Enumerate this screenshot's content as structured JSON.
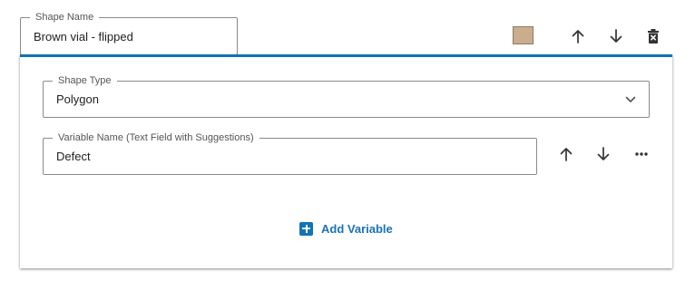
{
  "shape": {
    "name_legend": "Shape Name",
    "name_value": "Brown vial - flipped",
    "color": "#c9ad8d"
  },
  "shape_type": {
    "legend": "Shape Type",
    "value": "Polygon"
  },
  "variable": {
    "legend": "Variable Name (Text Field with Suggestions)",
    "value": "Defect"
  },
  "actions": {
    "add_variable_label": "Add Variable"
  },
  "colors": {
    "accent": "#0f73b6",
    "icon": "#333333"
  },
  "icons": [
    "arrow-up-icon",
    "arrow-down-icon",
    "delete-icon",
    "chevron-down-icon",
    "more-icon",
    "plus-icon"
  ]
}
